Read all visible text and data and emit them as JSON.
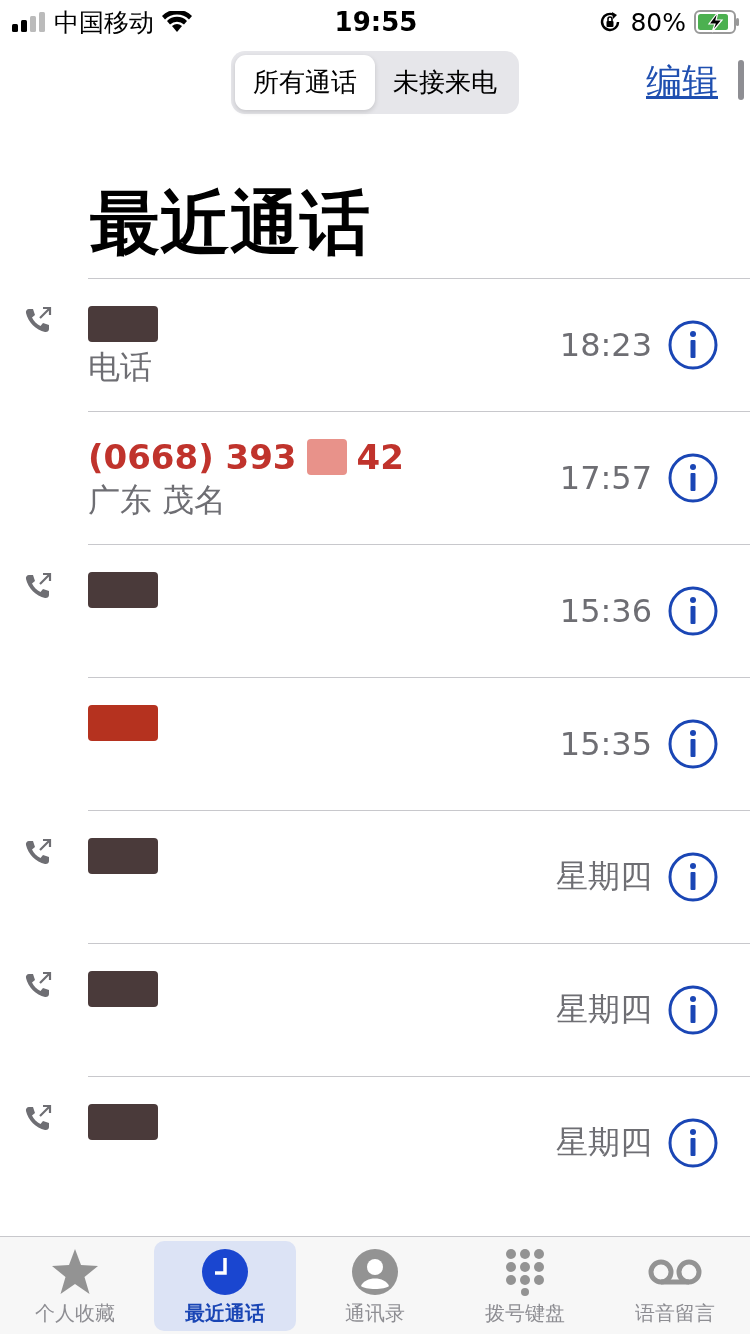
{
  "status_bar": {
    "carrier": "中国移动",
    "time": "19:55",
    "battery": "80%"
  },
  "segments": [
    {
      "label": "所有通话",
      "selected": true
    },
    {
      "label": "未接来电",
      "selected": false
    }
  ],
  "edit_link": "编辑",
  "title": "最近通话",
  "calls": [
    {
      "name_redacted": true,
      "subtitle": "电话",
      "time": "18:23",
      "missed": false,
      "outgoing": true
    },
    {
      "name_parts": [
        "(0668) 393",
        "42"
      ],
      "name_redacted": true,
      "subtitle": "广东 茂名",
      "time": "17:57",
      "missed": true,
      "outgoing": false
    },
    {
      "name_redacted": true,
      "time": "15:36",
      "missed": false,
      "outgoing": true
    },
    {
      "name_redacted": true,
      "time": "15:35",
      "missed": true,
      "outgoing": false
    },
    {
      "name_redacted": true,
      "time": "星期四",
      "missed": false,
      "outgoing": true
    },
    {
      "name_redacted": true,
      "time": "星期四",
      "missed": false,
      "outgoing": true
    },
    {
      "name_redacted": true,
      "time": "星期四",
      "missed": false,
      "outgoing": true
    }
  ],
  "tabs": [
    {
      "label": "个人收藏",
      "kind": "star",
      "selected": false
    },
    {
      "label": "最近通话",
      "kind": "clock",
      "selected": true
    },
    {
      "label": "通讯录",
      "kind": "person",
      "selected": false
    },
    {
      "label": "拨号键盘",
      "kind": "keypad",
      "selected": false
    },
    {
      "label": "语音留言",
      "kind": "voicemail",
      "selected": false
    }
  ]
}
